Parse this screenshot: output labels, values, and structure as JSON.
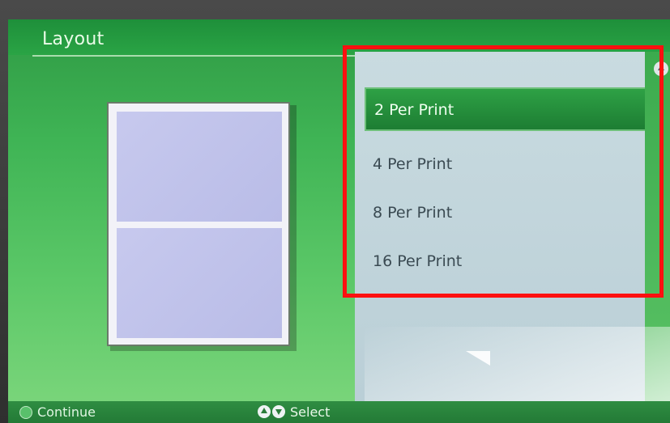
{
  "header": {
    "title": "Layout"
  },
  "layout_options": {
    "items": [
      {
        "label": "2 Per Print",
        "selected": true
      },
      {
        "label": "4 Per Print",
        "selected": false
      },
      {
        "label": "8 Per Print",
        "selected": false
      },
      {
        "label": "16 Per Print",
        "selected": false
      }
    ]
  },
  "footer": {
    "continue_label": "Continue",
    "select_label": "Select"
  },
  "colors": {
    "screen_green": "#3fb455",
    "selected_green": "#1d7d33",
    "highlight_red": "#ff1010"
  }
}
